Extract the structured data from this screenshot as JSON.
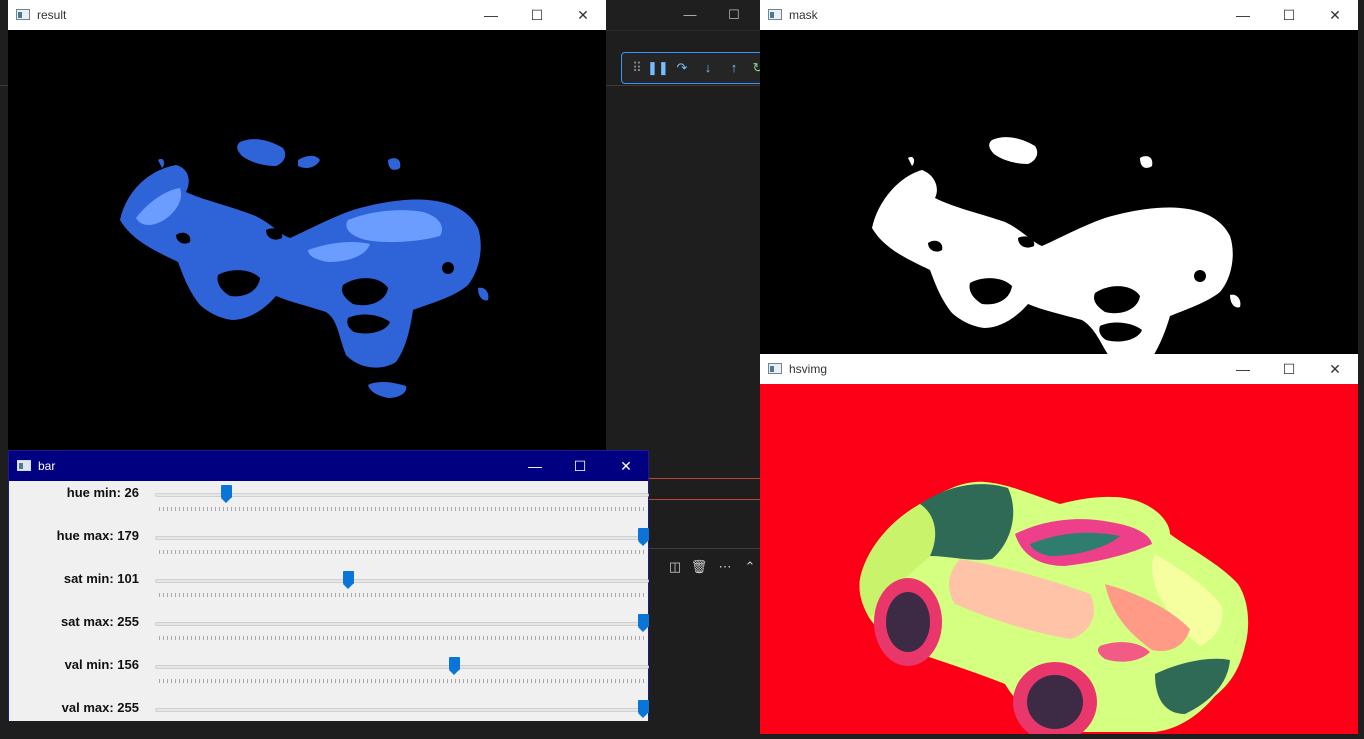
{
  "windows": {
    "result": {
      "title": "result"
    },
    "mask": {
      "title": "mask"
    },
    "hsvimg": {
      "title": "hsvimg"
    },
    "bar": {
      "title": "bar"
    }
  },
  "titlebar_buttons": {
    "minimize": "—",
    "maximize": "☐",
    "close": "✕"
  },
  "sliders": [
    {
      "label": "hue min: 26",
      "value": 26,
      "max": 179
    },
    {
      "label": "hue max: 179",
      "value": 179,
      "max": 179
    },
    {
      "label": "sat min: 101",
      "value": 101,
      "max": 255
    },
    {
      "label": "sat max: 255",
      "value": 255,
      "max": 255
    },
    {
      "label": "val min: 156",
      "value": 156,
      "max": 255
    },
    {
      "label": "val max: 255",
      "value": 255,
      "max": 255
    }
  ],
  "colors": {
    "accent": "#0a74d8",
    "hsv_background": "#fd0017",
    "result_car": "#2f63d8",
    "bar_titlebar": "#000080",
    "editor_bg": "#1e1e1e"
  },
  "icons": {
    "debug_toolbar": [
      "grip-icon",
      "pause-icon",
      "step-over-icon",
      "step-into-icon",
      "step-out-icon",
      "restart-icon"
    ],
    "panel": [
      "split-icon",
      "trash-icon",
      "more-icon",
      "chevron-up-icon"
    ]
  }
}
